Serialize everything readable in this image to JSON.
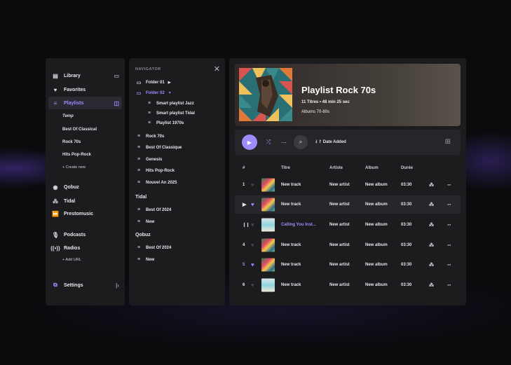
{
  "sidebar": {
    "library": "Library",
    "favorites": "Favorites",
    "playlists": "Playlists",
    "playlist_items": [
      "Temp",
      "Best Of Classical",
      "Rock 70s",
      "Hits Pop-Rock"
    ],
    "create_new": "+ Create new",
    "qobuz": "Qobuz",
    "tidal": "Tidal",
    "prestomusic": "Prestomusic",
    "podcasts": "Podcasts",
    "radios": "Radios",
    "add_url": "+ Add URL",
    "settings": "Settings"
  },
  "navigator": {
    "title": "NAVIGATOR",
    "folder1": "Folder 01",
    "folder2": "Folder 02",
    "folder2_children": [
      "Smart playlist Jazz",
      "Smart playlist Tidal",
      "Playlist 1970s"
    ],
    "playlists": [
      "Rock 70s",
      "Best Of Classique",
      "Genesis",
      "Hits Pop-Rock",
      "Nouvel An 2025"
    ],
    "tidal_label": "Tidal",
    "tidal_items": [
      "Best Of 2024",
      "New"
    ],
    "qobuz_label": "Qobuz",
    "qobuz_items": [
      "Best Of 2024",
      "New"
    ]
  },
  "header": {
    "title": "Playlist  Rock 70s",
    "meta": "11 Titres • 48 min 25 sec",
    "genre": "Albums 70-80s"
  },
  "toolbar": {
    "sort_label": "Date Added"
  },
  "table": {
    "columns": [
      "#",
      "Titre",
      "Artiste",
      "Album",
      "Durée"
    ],
    "rows": [
      {
        "num": "1",
        "title": "New track",
        "artist": "New artist",
        "album": "New album",
        "duration": "03:30",
        "liked": false
      },
      {
        "num": "",
        "title": "New track",
        "artist": "New artist",
        "album": "New album",
        "duration": "03:30",
        "liked": true
      },
      {
        "num": "",
        "title": "Calling You Inst...",
        "artist": "New artist",
        "album": "New album",
        "duration": "03:30",
        "liked": false
      },
      {
        "num": "4",
        "title": "New track",
        "artist": "New artist",
        "album": "New album",
        "duration": "03:30",
        "liked": false
      },
      {
        "num": "5",
        "title": "New track",
        "artist": "New artist",
        "album": "New album",
        "duration": "03:30",
        "liked": true
      },
      {
        "num": "6",
        "title": "New track",
        "artist": "New artist",
        "album": "New album",
        "duration": "03:30",
        "liked": false
      }
    ]
  },
  "colors": {
    "accent": "#9d8cff",
    "panel": "#1c1c1f",
    "background": "#0b0b0e"
  }
}
